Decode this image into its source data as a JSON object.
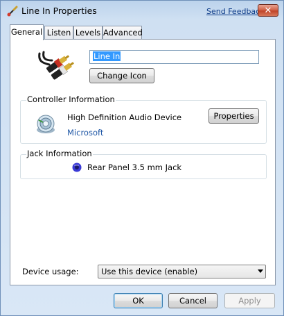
{
  "window": {
    "title": "Line In Properties",
    "send_feedback": "Send Feedback",
    "close_glyph": "✕"
  },
  "tabs": [
    {
      "label": "General",
      "active": true
    },
    {
      "label": "Listen",
      "active": false
    },
    {
      "label": "Levels",
      "active": false
    },
    {
      "label": "Advanced",
      "active": false
    }
  ],
  "general": {
    "device_name_value": "Line In",
    "change_icon_label": "Change Icon",
    "controller": {
      "group_label": "Controller Information",
      "name": "High Definition Audio Device",
      "vendor": "Microsoft",
      "properties_label": "Properties"
    },
    "jack": {
      "group_label": "Jack Information",
      "text": "Rear Panel 3.5 mm Jack",
      "color": "#3a3ad6"
    },
    "device_usage": {
      "label": "Device usage:",
      "selected": "Use this device (enable)"
    }
  },
  "footer": {
    "ok_label": "OK",
    "cancel_label": "Cancel",
    "apply_label": "Apply"
  },
  "icons": {
    "app": "audio-cable-icon",
    "device": "rca-cable-icon",
    "controller": "audio-device-icon",
    "jack": "jack-color-icon"
  }
}
